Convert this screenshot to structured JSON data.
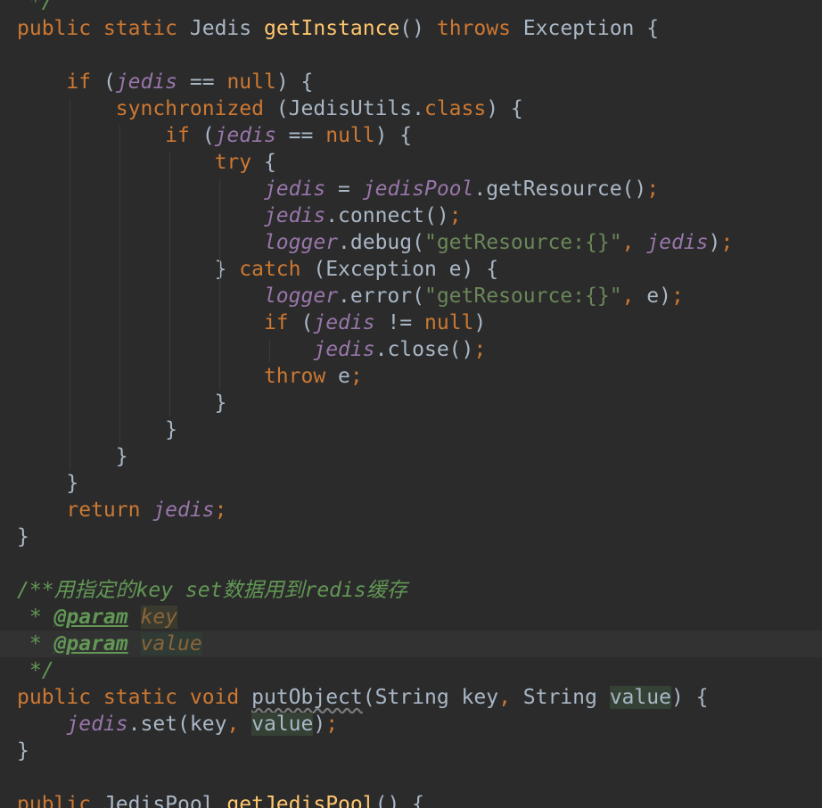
{
  "editor": {
    "language": "Java",
    "theme_colors": {
      "background": "#2b2b2b",
      "keyword": "#cc7832",
      "method": "#ffc66d",
      "string": "#6a8759",
      "field": "#9876aa",
      "doc_comment": "#629755",
      "plain": "#a9b7c6"
    },
    "lines": [
      [
        {
          "t": " */",
          "c": "cm"
        }
      ],
      [
        {
          "t": "public static ",
          "c": "k"
        },
        {
          "t": "Jedis "
        },
        {
          "t": "getInstance",
          "c": "f"
        },
        {
          "t": "() "
        },
        {
          "t": "throws ",
          "c": "k"
        },
        {
          "t": "Exception {"
        }
      ],
      [],
      [
        {
          "t": "    "
        },
        {
          "t": "if ",
          "c": "k"
        },
        {
          "t": "("
        },
        {
          "t": "jedis",
          "c": "fld"
        },
        {
          "t": " == "
        },
        {
          "t": "null",
          "c": "k"
        },
        {
          "t": ") {"
        }
      ],
      [
        {
          "t": "        "
        },
        {
          "t": "synchronized ",
          "c": "k"
        },
        {
          "t": "(JedisUtils."
        },
        {
          "t": "class",
          "c": "k"
        },
        {
          "t": ") {"
        }
      ],
      [
        {
          "t": "            "
        },
        {
          "t": "if ",
          "c": "k"
        },
        {
          "t": "("
        },
        {
          "t": "jedis",
          "c": "fld"
        },
        {
          "t": " == "
        },
        {
          "t": "null",
          "c": "k"
        },
        {
          "t": ") {"
        }
      ],
      [
        {
          "t": "                "
        },
        {
          "t": "try ",
          "c": "k"
        },
        {
          "t": "{"
        }
      ],
      [
        {
          "t": "                    "
        },
        {
          "t": "jedis",
          "c": "fld"
        },
        {
          "t": " = "
        },
        {
          "t": "jedisPool",
          "c": "fld"
        },
        {
          "t": ".getResource()"
        },
        {
          "t": ";",
          "c": "k"
        }
      ],
      [
        {
          "t": "                    "
        },
        {
          "t": "jedis",
          "c": "fld"
        },
        {
          "t": ".connect()"
        },
        {
          "t": ";",
          "c": "k"
        }
      ],
      [
        {
          "t": "                    "
        },
        {
          "t": "logger",
          "c": "fld"
        },
        {
          "t": ".debug("
        },
        {
          "t": "\"getResource:{}\"",
          "c": "s"
        },
        {
          "t": ", ",
          "c": "k"
        },
        {
          "t": "jedis",
          "c": "fld"
        },
        {
          "t": ")"
        },
        {
          "t": ";",
          "c": "k"
        }
      ],
      [
        {
          "t": "                } "
        },
        {
          "t": "catch ",
          "c": "k"
        },
        {
          "t": "(Exception e) {"
        }
      ],
      [
        {
          "t": "                    "
        },
        {
          "t": "logger",
          "c": "fld"
        },
        {
          "t": ".error("
        },
        {
          "t": "\"getResource:{}\"",
          "c": "s"
        },
        {
          "t": ", ",
          "c": "k"
        },
        {
          "t": "e)"
        },
        {
          "t": ";",
          "c": "k"
        }
      ],
      [
        {
          "t": "                    "
        },
        {
          "t": "if ",
          "c": "k"
        },
        {
          "t": "("
        },
        {
          "t": "jedis",
          "c": "fld"
        },
        {
          "t": " != "
        },
        {
          "t": "null",
          "c": "k"
        },
        {
          "t": ")"
        }
      ],
      [
        {
          "t": "                        "
        },
        {
          "t": "jedis",
          "c": "fld"
        },
        {
          "t": ".close()"
        },
        {
          "t": ";",
          "c": "k"
        }
      ],
      [
        {
          "t": "                    "
        },
        {
          "t": "throw ",
          "c": "k"
        },
        {
          "t": "e"
        },
        {
          "t": ";",
          "c": "k"
        }
      ],
      [
        {
          "t": "                }"
        }
      ],
      [
        {
          "t": "            }"
        }
      ],
      [
        {
          "t": "        }"
        }
      ],
      [
        {
          "t": "    }"
        }
      ],
      [
        {
          "t": "    "
        },
        {
          "t": "return ",
          "c": "k"
        },
        {
          "t": "jedis",
          "c": "fld"
        },
        {
          "t": ";",
          "c": "k"
        }
      ],
      [
        {
          "t": "}"
        }
      ],
      [],
      [
        {
          "t": "/**用指定的key set数据用到redis缓存",
          "c": "cm"
        }
      ],
      [
        {
          "t": " * ",
          "c": "cm"
        },
        {
          "t": "@param",
          "c": "tag"
        },
        {
          "t": " ",
          "c": "cm"
        },
        {
          "t": "key",
          "c": "pv pv1"
        }
      ],
      [
        {
          "t": " * ",
          "c": "cm"
        },
        {
          "t": "@param",
          "c": "tag"
        },
        {
          "t": " ",
          "c": "cm"
        },
        {
          "t": "value",
          "c": "pv pv2"
        }
      ],
      [
        {
          "t": " */",
          "c": "cm"
        }
      ],
      [
        {
          "t": "public static void ",
          "c": "k"
        },
        {
          "t": "putObject",
          "c": "warn"
        },
        {
          "t": "(String key"
        },
        {
          "t": ", ",
          "c": "k"
        },
        {
          "t": "String "
        },
        {
          "t": "value",
          "c": "used"
        },
        {
          "t": ") {"
        }
      ],
      [
        {
          "t": "    "
        },
        {
          "t": "jedis",
          "c": "fld"
        },
        {
          "t": ".set(key"
        },
        {
          "t": ", ",
          "c": "k"
        },
        {
          "t": "value",
          "c": "used"
        },
        {
          "t": ")"
        },
        {
          "t": ";",
          "c": "k"
        }
      ],
      [
        {
          "t": "}"
        }
      ],
      [],
      [
        {
          "t": "public ",
          "c": "k"
        },
        {
          "t": "JedisPool "
        },
        {
          "t": "getJedisPool",
          "c": "f"
        },
        {
          "t": "() {"
        }
      ]
    ]
  }
}
